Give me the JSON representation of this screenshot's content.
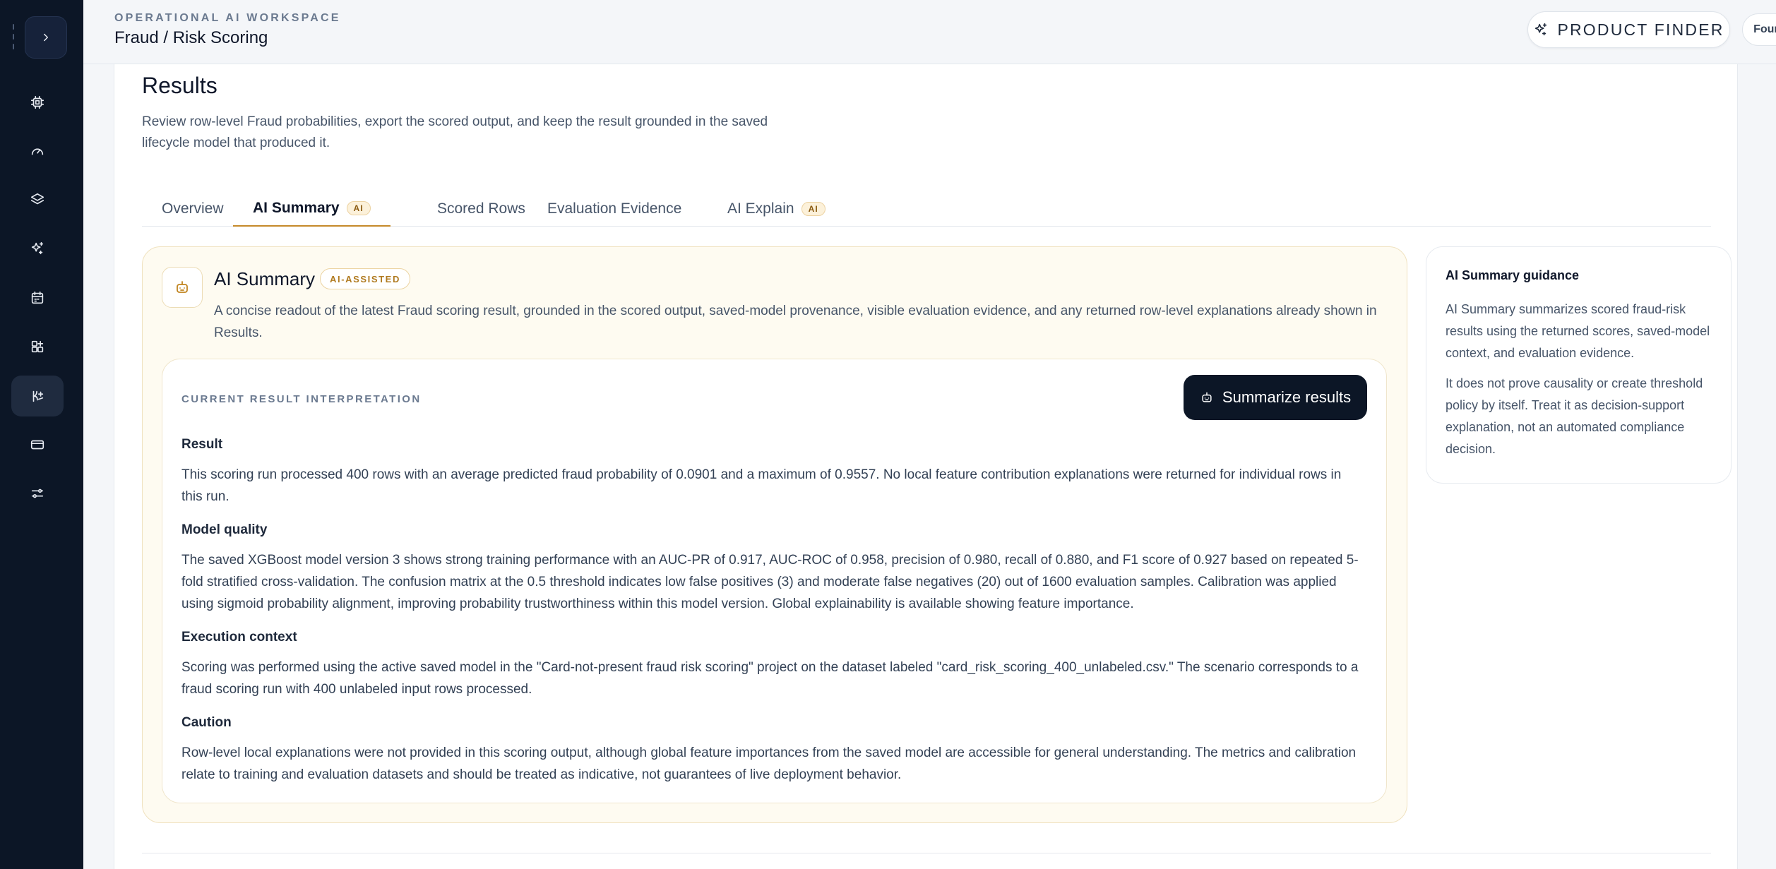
{
  "header": {
    "eyebrow": "OPERATIONAL AI WORKSPACE",
    "title": "Fraud / Risk Scoring",
    "product_finder_label": "PRODUCT FINDER",
    "account_label": "Founder account"
  },
  "sidebar": {
    "items": [
      {
        "icon": "chip-icon",
        "active": false
      },
      {
        "icon": "gauge-icon",
        "active": false
      },
      {
        "icon": "layers-icon",
        "active": false
      },
      {
        "icon": "sparkles-icon",
        "active": false
      },
      {
        "icon": "calendar-icon",
        "active": false
      },
      {
        "icon": "widgets-icon",
        "active": false
      },
      {
        "icon": "scoring-icon",
        "active": true
      },
      {
        "icon": "card-icon",
        "active": false
      },
      {
        "icon": "sliders-icon",
        "active": false
      }
    ]
  },
  "results": {
    "title": "Results",
    "description": "Review row-level Fraud probabilities, export the scored output, and keep the result grounded in the saved lifecycle model that produced it."
  },
  "tabs": [
    {
      "label": "Overview",
      "badge": null,
      "active": false
    },
    {
      "label": "AI Summary",
      "badge": "AI",
      "active": true
    },
    {
      "label": "Scored Rows",
      "badge": null,
      "active": false
    },
    {
      "label": "Evaluation Evidence",
      "badge": null,
      "active": false
    },
    {
      "label": "AI Explain",
      "badge": "AI",
      "active": false
    }
  ],
  "ai_summary": {
    "title": "AI Summary",
    "badge": "AI-ASSISTED",
    "description": "A concise readout of the latest Fraud scoring result, grounded in the scored output, saved-model provenance, visible evaluation evidence, and any returned row-level explanations already shown in Results.",
    "eyebrow": "CURRENT RESULT INTERPRETATION",
    "button_label": "Summarize results",
    "sections": [
      {
        "heading": "Result",
        "body": "This scoring run processed 400 rows with an average predicted fraud probability of 0.0901 and a maximum of 0.9557. No local feature contribution explanations were returned for individual rows in this run."
      },
      {
        "heading": "Model quality",
        "body": "The saved XGBoost model version 3 shows strong training performance with an AUC-PR of 0.917, AUC-ROC of 0.958, precision of 0.980, recall of 0.880, and F1 score of 0.927 based on repeated 5-fold stratified cross-validation. The confusion matrix at the 0.5 threshold indicates low false positives (3) and moderate false negatives (20) out of 1600 evaluation samples. Calibration was applied using sigmoid probability alignment, improving probability trustworthiness within this model version. Global explainability is available showing feature importance."
      },
      {
        "heading": "Execution context",
        "body": "Scoring was performed using the active saved model in the \"Card-not-present fraud risk scoring\" project on the dataset labeled \"card_risk_scoring_400_unlabeled.csv.\" The scenario corresponds to a fraud scoring run with 400 unlabeled input rows processed."
      },
      {
        "heading": "Caution",
        "body": "Row-level local explanations were not provided in this scoring output, although global feature importances from the saved model are accessible for general understanding. The metrics and calibration relate to training and evaluation datasets and should be treated as indicative, not guarantees of live deployment behavior."
      }
    ]
  },
  "guidance": {
    "title": "AI Summary guidance",
    "paragraphs": [
      "AI Summary summarizes scored fraud-risk results using the returned scores, saved-model context, and evaluation evidence.",
      "It does not prove causality or create threshold policy by itself. Treat it as decision-support explanation, not an automated compliance decision."
    ]
  },
  "colors": {
    "sidebar_bg": "#0c1626",
    "accent": "#c58a2a",
    "panel_bg": "#fefbf1",
    "primary_button": "#0c1626"
  }
}
